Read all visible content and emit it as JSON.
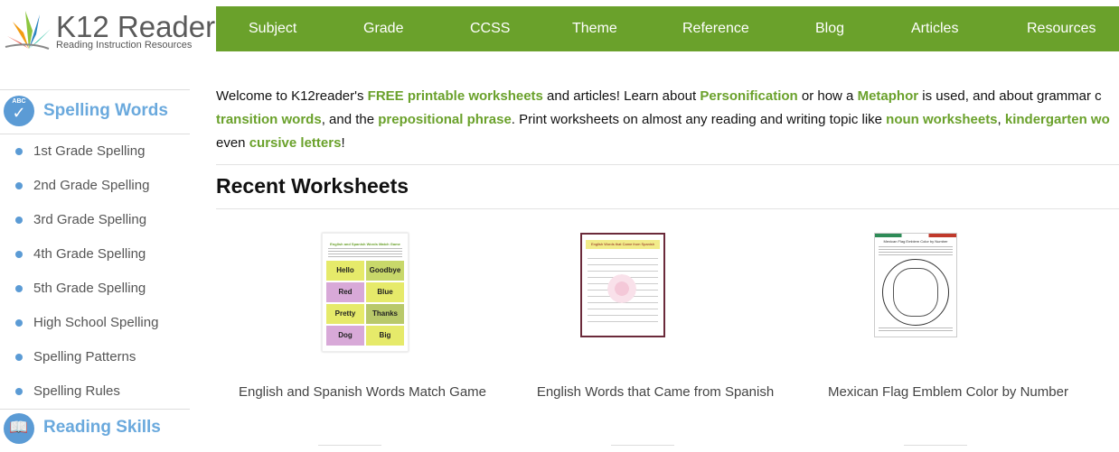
{
  "logo": {
    "title": "K12 Reader",
    "subtitle": "Reading Instruction Resources"
  },
  "nav": [
    "Subject",
    "Grade",
    "CCSS",
    "Theme",
    "Reference",
    "Blog",
    "Articles",
    "Resources"
  ],
  "sidebar": {
    "section1": {
      "badge_text": "ABC",
      "title": "Spelling Words",
      "items": [
        "1st Grade Spelling",
        "2nd Grade Spelling",
        "3rd Grade Spelling",
        "4th Grade Spelling",
        "5th Grade Spelling",
        "High School Spelling",
        "Spelling Patterns",
        "Spelling Rules"
      ]
    },
    "section2": {
      "title": "Reading Skills"
    }
  },
  "intro": {
    "line1": {
      "t1": "Welcome to K12reader's ",
      "l1": "FREE printable worksheets",
      "t2": " and articles! Learn about ",
      "l2": "Personification",
      "t3": " or how a ",
      "l3": "Metaphor",
      "t4": " is used, and about grammar c"
    },
    "line2": {
      "l1": "transition words",
      "t1": ", and the ",
      "l2": "prepositional phrase",
      "t2": ". Print worksheets on almost any reading and writing topic like ",
      "l3": "noun worksheets",
      "t3": ", ",
      "l4": "kindergarten wo"
    },
    "line3": {
      "t1": "even ",
      "l1": "cursive letters",
      "t2": "!"
    }
  },
  "recent": {
    "title": "Recent Worksheets",
    "items": [
      {
        "caption": "English and Spanish Words Match Game",
        "thumb_title": "English and Spanish Words Match Game",
        "cells": [
          "Hello",
          "Goodbye",
          "Red",
          "Blue",
          "Pretty",
          "Thanks",
          "Dog",
          "Big"
        ]
      },
      {
        "caption": "English Words that Came from Spanish",
        "thumb_title": "English Words that Came from Spanish"
      },
      {
        "caption": "Mexican Flag Emblem Color by Number",
        "thumb_title": "Mexican Flag Emblem Color by Number"
      }
    ]
  },
  "colors": {
    "nav_green": "#6aa12b",
    "link_green": "#6aa12b",
    "sidebar_blue": "#5b9bd5",
    "sidebar_title": "#6aa9dd"
  }
}
